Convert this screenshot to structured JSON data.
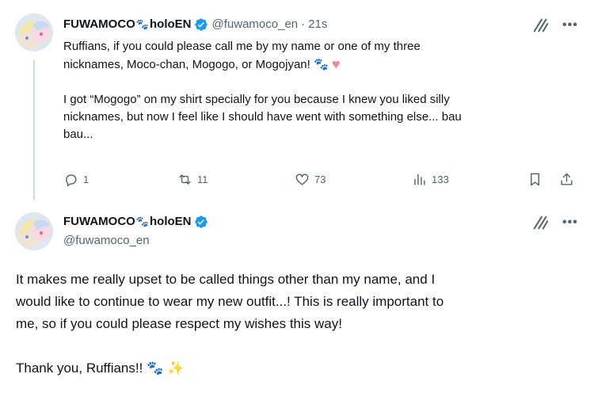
{
  "tweet1": {
    "display_name": "FUWAMOCO",
    "name_suffix": "holoEN",
    "handle": "@fuwamoco_en",
    "separator": "·",
    "time": "21s",
    "line1": "Ruffians, if you could please call me by my name or one of my three",
    "line2": "nicknames, Moco-chan, Mogogo, or Mogojyan!",
    "line3": "I got “Mogogo” on my shirt specially for you because I knew you liked silly",
    "line4": "nicknames, but now I feel like I should have went with something else... bau",
    "line5": "bau...",
    "actions": {
      "reply_count": "1",
      "retweet_count": "11",
      "like_count": "73",
      "view_count": "133"
    }
  },
  "tweet2": {
    "display_name": "FUWAMOCO",
    "name_suffix": "holoEN",
    "handle": "@fuwamoco_en",
    "line1": "It makes me really upset to be called things other than my name, and I",
    "line2": "would like to continue to wear my new outfit...! This is really important to",
    "line3": "me, so if you could please respect my wishes this way!",
    "line4": "Thank you, Ruffians!!"
  },
  "icons": {
    "paw": "🐾",
    "heart": "♥",
    "sparkle": "✨",
    "more": "•••"
  },
  "colors": {
    "verified": "#1d9bf0",
    "secondary_text": "#536471",
    "thread_line": "#cfd9de"
  }
}
